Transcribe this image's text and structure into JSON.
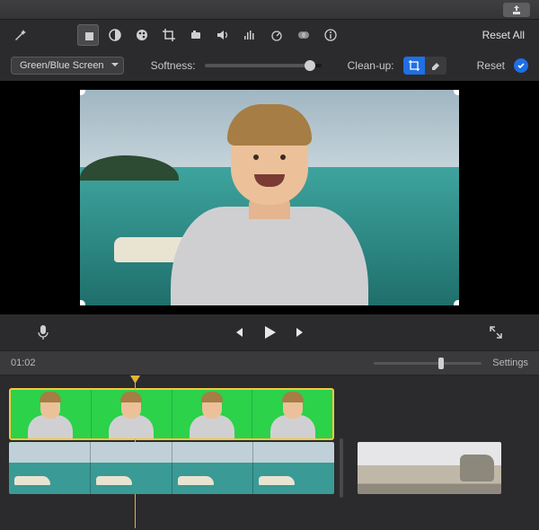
{
  "titlebar": {
    "share_icon": "share-icon"
  },
  "toolbar": {
    "wand_icon": "magic-wand-icon",
    "items": [
      {
        "name": "overlay-icon",
        "active": true
      },
      {
        "name": "color-balance-icon",
        "active": false
      },
      {
        "name": "color-palette-icon",
        "active": false
      },
      {
        "name": "crop-icon",
        "active": false
      },
      {
        "name": "stabilize-icon",
        "active": false
      },
      {
        "name": "volume-icon",
        "active": false
      },
      {
        "name": "equalizer-icon",
        "active": false
      },
      {
        "name": "speed-icon",
        "active": false
      },
      {
        "name": "filter-icon",
        "active": false
      },
      {
        "name": "info-icon",
        "active": false
      }
    ],
    "reset_all_label": "Reset All"
  },
  "controls": {
    "overlay_mode": "Green/Blue Screen",
    "softness_label": "Softness:",
    "softness_value": 90,
    "cleanup_label": "Clean-up:",
    "cleanup_seg": [
      {
        "name": "cleanup-crop-icon",
        "active": true
      },
      {
        "name": "cleanup-eraser-icon",
        "active": false
      }
    ],
    "reset_label": "Reset"
  },
  "transport": {
    "mic_icon": "microphone-icon",
    "prev_icon": "skip-back-icon",
    "play_icon": "play-icon",
    "next_icon": "skip-forward-icon",
    "expand_icon": "expand-icon"
  },
  "timebar": {
    "timecode": "01:02",
    "zoom_value": 60,
    "settings_label": "Settings"
  },
  "timeline": {
    "greenscreen_clips": 4,
    "background_clips": 4,
    "extra_clip": "beach-clip"
  }
}
